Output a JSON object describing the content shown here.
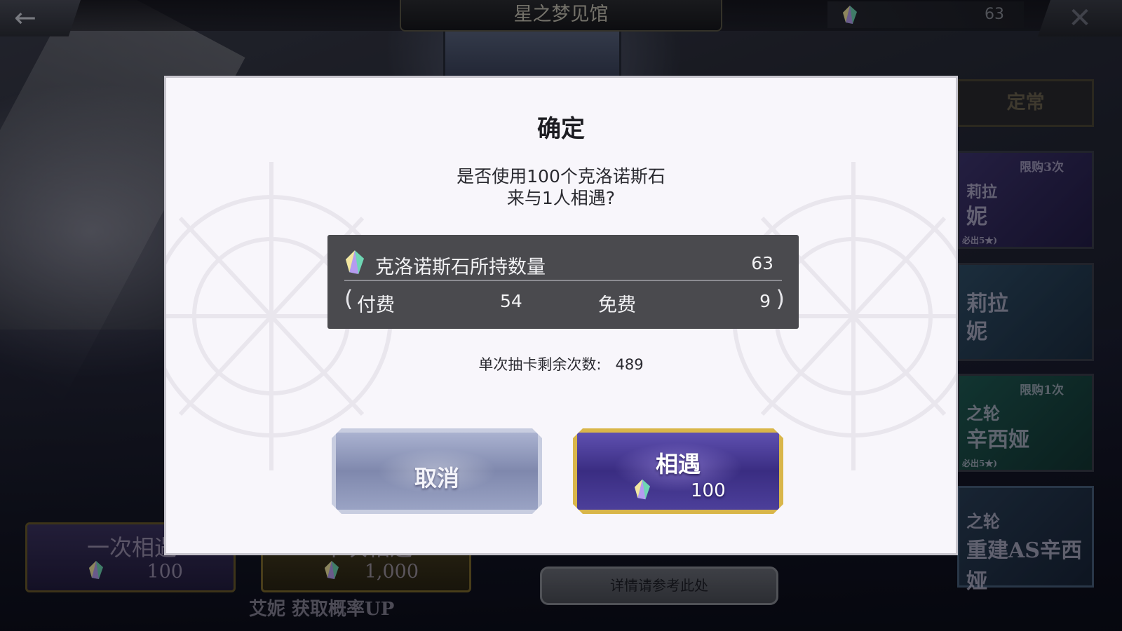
{
  "header": {
    "title": "星之梦见馆",
    "currency_amount": "63",
    "back_icon": "back-arrow-icon",
    "close_icon": "close-icon"
  },
  "side_panels": {
    "regular_tab": "定常",
    "panel1": {
      "limit": "限购3次",
      "line1": "莉拉",
      "line2": "妮",
      "note": "必出5★)"
    },
    "panel2": {
      "line1": "莉拉",
      "line2": "妮"
    },
    "panel3": {
      "limit": "限购1次",
      "line1": "之轮",
      "line2": "辛西娅",
      "note": "必出5★)"
    },
    "panel4": {
      "line1": "之轮",
      "line2": "重建AS辛西娅"
    }
  },
  "bottom": {
    "single_pull_label": "一次相遇",
    "single_pull_cost": "100",
    "ten_pull_label": "十次相遇",
    "ten_pull_cost": "1,000",
    "rate_up": "艾妮 获取概率UP",
    "details_button": "详情请参考此处"
  },
  "dialog": {
    "title": "确定",
    "message_line1": "是否使用100个克洛诺斯石",
    "message_line2": "来与1人相遇?",
    "stone_label": "克洛诺斯石所持数量",
    "stone_total": "63",
    "paren_open": "(",
    "paid_label": "付费",
    "paid_value": "54",
    "free_label": "免费",
    "free_value": "9",
    "paren_close": ")",
    "remaining_label": "单次抽卡剩余次数:",
    "remaining_value": "489",
    "cancel_button": "取消",
    "confirm_button": "相遇",
    "confirm_cost": "100"
  },
  "colors": {
    "dialog_bg": "#f8f6fb",
    "stone_box_bg": "#4a4a4e",
    "confirm_border": "#d9b64a",
    "confirm_fill": "#3a2d82",
    "cancel_fill": "#8f98bb"
  }
}
